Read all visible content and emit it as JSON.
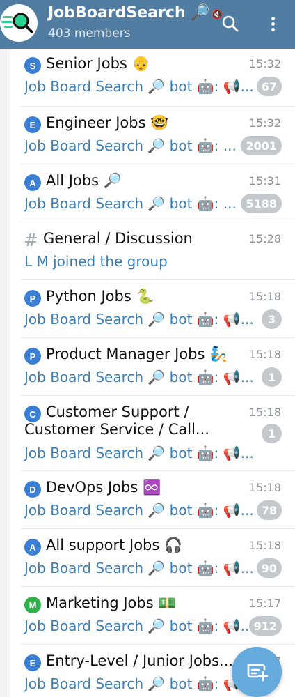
{
  "header": {
    "title": "JobBoardSearch 🔎",
    "mute_icon": "🔇",
    "members": "403 members"
  },
  "colors": {
    "header_bg": "#517da2",
    "preview_text": "#3c7eb3",
    "count_badge": "#c4c9ce",
    "fab": "#65aadd"
  },
  "chats": [
    {
      "letter": "S",
      "letter_color": "#3b7fd4",
      "title": "Senior Jobs 👴",
      "time": "15:32",
      "preview": "Job Board Search 🔎 bot 🤖: 📢...",
      "count": "67"
    },
    {
      "letter": "E",
      "letter_color": "#3b7fd4",
      "title": "Engineer Jobs 🤓",
      "time": "15:32",
      "preview": "Job Board Search 🔎 bot 🤖: ...",
      "count": "2001"
    },
    {
      "letter": "A",
      "letter_color": "#3b7fd4",
      "title": "All Jobs 🔎",
      "time": "15:31",
      "preview": "Job Board Search 🔎 bot 🤖: ...",
      "count": "5188"
    },
    {
      "letter": "#",
      "letter_color": "",
      "title": "General / Discussion",
      "time": "15:28",
      "preview": "L M joined the group",
      "count": ""
    },
    {
      "letter": "P",
      "letter_color": "#3b7fd4",
      "title": "Python Jobs 🐍",
      "time": "15:18",
      "preview": "Job Board Search 🔎 bot 🤖: 📢...",
      "count": "3"
    },
    {
      "letter": "P",
      "letter_color": "#3b7fd4",
      "title": "Product Manager Jobs 🧞",
      "time": "15:18",
      "preview": "Job Board Search 🔎 bot 🤖: 📢...",
      "count": "1"
    },
    {
      "letter": "C",
      "letter_color": "#3b7fd4",
      "title": "Customer Support /",
      "title_line2": "Customer Service / Call...",
      "time": "15:18",
      "preview": "Job Board Search 🔎 bot 🤖: 📢...",
      "count": "1"
    },
    {
      "letter": "D",
      "letter_color": "#3b7fd4",
      "title": "DevOps Jobs ♾️",
      "time": "15:18",
      "preview": "Job Board Search 🔎 bot 🤖: 📢...",
      "count": "78"
    },
    {
      "letter": "A",
      "letter_color": "#3b7fd4",
      "title": "All support Jobs 🎧",
      "time": "15:18",
      "preview": "Job Board Search 🔎 bot 🤖: 📢...",
      "count": "90"
    },
    {
      "letter": "M",
      "letter_color": "#2fb14a",
      "title": "Marketing Jobs 💵",
      "time": "15:17",
      "preview": "Job Board Search 🔎 bot 🤖: 📢...",
      "count": "912"
    },
    {
      "letter": "E",
      "letter_color": "#3b7fd4",
      "title": "Entry-Level / Junior Jobs...",
      "time": "15:17",
      "preview": "Job Board Search 🔎 bot 🤖: 📢...",
      "count": ""
    }
  ]
}
